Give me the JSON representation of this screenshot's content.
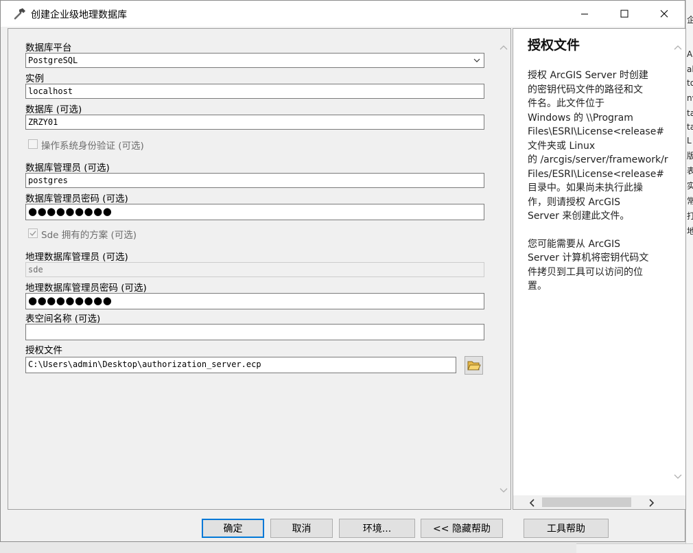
{
  "window": {
    "title": "创建企业级地理数据库",
    "icon": "hammer-icon"
  },
  "form": {
    "platform_label": "数据库平台",
    "platform_value": "PostgreSQL",
    "instance_label": "实例",
    "instance_value": "localhost",
    "database_label": "数据库 (可选)",
    "database_value": "ZRZY01",
    "os_auth_label": "操作系统身份验证 (可选)",
    "os_auth_checked": false,
    "dba_label": "数据库管理员 (可选)",
    "dba_value": "postgres",
    "dba_pwd_label": "数据库管理员密码 (可选)",
    "dba_pwd_value": "●●●●●●●●●",
    "sde_schema_label": "Sde 拥有的方案 (可选)",
    "sde_schema_checked": true,
    "gdb_admin_label": "地理数据库管理员 (可选)",
    "gdb_admin_value": "sde",
    "gdb_pwd_label": "地理数据库管理员密码 (可选)",
    "gdb_pwd_value": "●●●●●●●●●",
    "tablespace_label": "表空间名称 (可选)",
    "tablespace_value": "",
    "auth_file_label": "授权文件",
    "auth_file_value": "C:\\Users\\admin\\Desktop\\authorization_server.ecp"
  },
  "help": {
    "title": "授权文件",
    "para1": "授权 ArcGIS Server 时创建\n的密钥代码文件的路径和文\n件名。此文件位于\nWindows 的 \\\\Program\nFiles\\ESRI\\License<release#\n文件夹或 Linux\n的 /arcgis/server/framework/r\nFiles/ESRI\\License<release#\n目录中。如果尚未执行此操\n作，则请授权 ArcGIS\nServer 来创建此文件。",
    "para2": "您可能需要从 ArcGIS\nServer 计算机将密钥代码文\n件拷贝到工具可以访问的位\n置。"
  },
  "buttons": {
    "ok": "确定",
    "cancel": "取消",
    "environments": "环境...",
    "hide_help": "<< 隐藏帮助",
    "tool_help": "工具帮助"
  },
  "background_chars": [
    "企",
    "A",
    "aly",
    "to",
    "nv",
    "ta",
    "ta",
    "L",
    "版",
    "表",
    "实",
    "常",
    "打",
    "地"
  ]
}
